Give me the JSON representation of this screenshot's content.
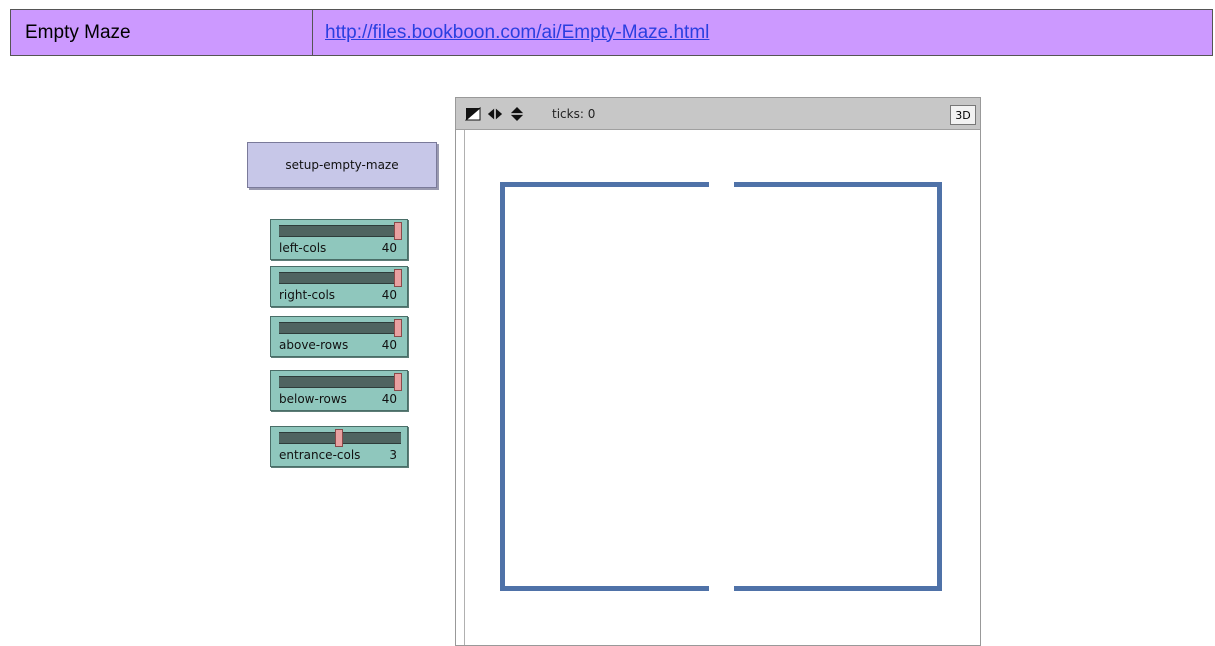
{
  "header": {
    "title": "Empty Maze",
    "link": "http://files.bookboon.com/ai/Empty-Maze.html"
  },
  "button": {
    "label": "setup-empty-maze"
  },
  "sliders": [
    {
      "label": "left-cols",
      "value": "40",
      "fraction": 1.0
    },
    {
      "label": "right-cols",
      "value": "40",
      "fraction": 1.0
    },
    {
      "label": "above-rows",
      "value": "40",
      "fraction": 1.0
    },
    {
      "label": "below-rows",
      "value": "40",
      "fraction": 1.0
    },
    {
      "label": "entrance-cols",
      "value": "3",
      "fraction": 0.5
    }
  ],
  "view": {
    "ticks": "ticks: 0",
    "btn3d": "3D",
    "icons": [
      "edit-shape-icon",
      "horizontal-wrap-icon",
      "vertical-wrap-icon"
    ]
  },
  "colors": {
    "header_bg": "#cc99ff",
    "wall": "#4f72a8",
    "slider_bg": "#8fc7bd",
    "button_bg": "#c7c7e8"
  }
}
